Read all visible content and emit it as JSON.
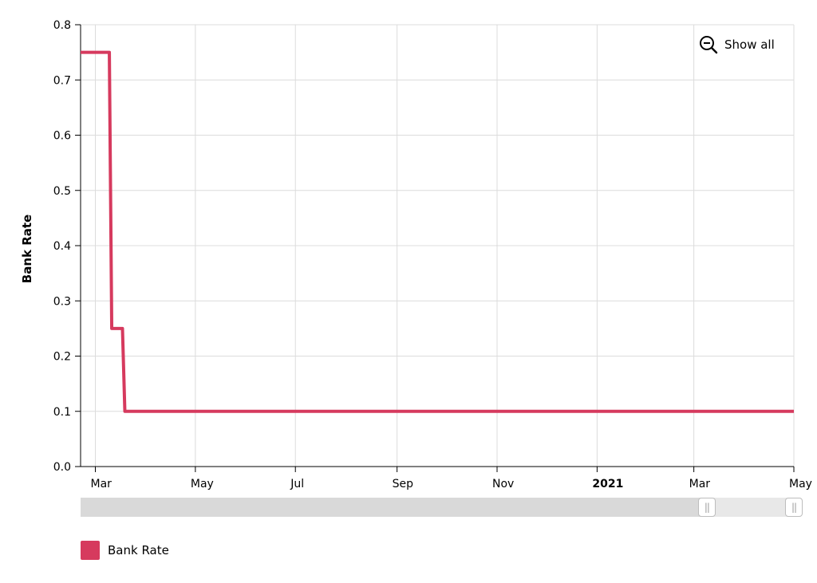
{
  "chart_data": {
    "type": "line",
    "step": true,
    "title": "",
    "xlabel": "",
    "ylabel": "Bank Rate",
    "ylim": [
      0,
      0.8
    ],
    "yticks": [
      0.0,
      0.1,
      0.2,
      0.3,
      0.4,
      0.5,
      0.6,
      0.7,
      0.8
    ],
    "ytick_labels": [
      "0.0",
      "0.1",
      "0.2",
      "0.3",
      "0.4",
      "0.5",
      "0.6",
      "0.7",
      "0.8"
    ],
    "xlim": [
      "2020-02-21",
      "2021-05-01"
    ],
    "xticks": [
      {
        "date": "2020-03-01",
        "label": "Mar",
        "bold": false
      },
      {
        "date": "2020-05-01",
        "label": "May",
        "bold": false
      },
      {
        "date": "2020-07-01",
        "label": "Jul",
        "bold": false
      },
      {
        "date": "2020-09-01",
        "label": "Sep",
        "bold": false
      },
      {
        "date": "2020-11-01",
        "label": "Nov",
        "bold": false
      },
      {
        "date": "2021-01-01",
        "label": "2021",
        "bold": true
      },
      {
        "date": "2021-03-01",
        "label": "Mar",
        "bold": false
      },
      {
        "date": "2021-05-01",
        "label": "May",
        "bold": false
      }
    ],
    "grid": true,
    "legend_position": "bottom-left",
    "series": [
      {
        "name": "Bank Rate",
        "color": "#d63a5e",
        "x": [
          "2020-02-21",
          "2020-03-11",
          "2020-03-19",
          "2021-05-01"
        ],
        "y": [
          0.75,
          0.25,
          0.1,
          0.1
        ]
      }
    ]
  },
  "controls": {
    "show_all_label": "Show all",
    "show_all_icon": "zoom-out-icon",
    "scrollbar_range": [
      0.878,
      1.0
    ]
  },
  "legend": {
    "items": [
      {
        "label": "Bank Rate",
        "color": "#d63a5e"
      }
    ]
  }
}
